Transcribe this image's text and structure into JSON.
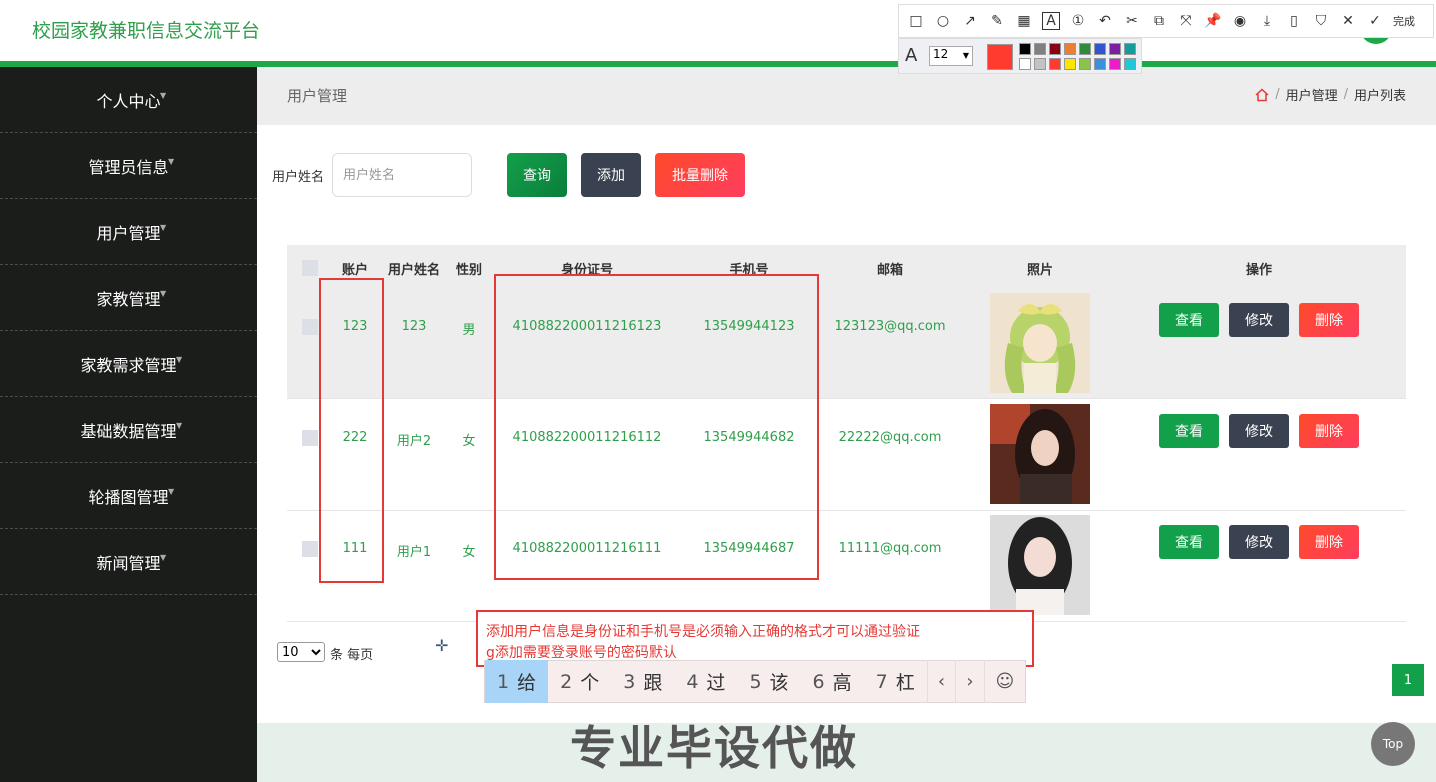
{
  "header": {
    "title": "校园家教兼职信息交流平台"
  },
  "sidebar": {
    "items": [
      {
        "label": "个人中心"
      },
      {
        "label": "管理员信息"
      },
      {
        "label": "用户管理"
      },
      {
        "label": "家教管理"
      },
      {
        "label": "家教需求管理"
      },
      {
        "label": "基础数据管理"
      },
      {
        "label": "轮播图管理"
      },
      {
        "label": "新闻管理"
      }
    ]
  },
  "page": {
    "title": "用户管理",
    "breadcrumb": [
      "用户管理",
      "用户列表"
    ],
    "breadcrumb_sep": "/"
  },
  "search": {
    "label": "用户姓名",
    "placeholder": "用户姓名",
    "query_label": "查询",
    "add_label": "添加",
    "batch_delete_label": "批量删除"
  },
  "table": {
    "columns": [
      "账户",
      "用户姓名",
      "性别",
      "身份证号",
      "手机号",
      "邮箱",
      "照片",
      "操作"
    ],
    "rows": [
      {
        "account": "123",
        "name": "123",
        "gender": "男",
        "id_card": "410882200011216123",
        "phone": "13549944123",
        "email": "123123@qq.com"
      },
      {
        "account": "222",
        "name": "用户2",
        "gender": "女",
        "id_card": "410882200011216112",
        "phone": "13549944682",
        "email": "22222@qq.com"
      },
      {
        "account": "111",
        "name": "用户1",
        "gender": "女",
        "id_card": "410882200011216111",
        "phone": "13549944687",
        "email": "11111@qq.com"
      }
    ],
    "actions": {
      "view": "查看",
      "edit": "修改",
      "delete": "删除"
    }
  },
  "annotation": {
    "line1": "添加用户信息是身份证和手机号是必须输入正确的格式才可以通过验证",
    "line2": "g添加需要登录账号的密码默认"
  },
  "pagination": {
    "page_size": "10",
    "page_size_label": "条 每页",
    "current_page": "1",
    "top_label": "Top"
  },
  "ime": {
    "candidates": [
      {
        "n": "1",
        "c": "给"
      },
      {
        "n": "2",
        "c": "个"
      },
      {
        "n": "3",
        "c": "跟"
      },
      {
        "n": "4",
        "c": "过"
      },
      {
        "n": "5",
        "c": "该"
      },
      {
        "n": "6",
        "c": "高"
      },
      {
        "n": "7",
        "c": "杠"
      }
    ],
    "prev": "‹",
    "next": "›",
    "emoji": "☺"
  },
  "watermark": "专业毕设代做",
  "screenshot_toolbar": {
    "done_label": "完成",
    "font_size": "12",
    "font_glyph": "A",
    "selected_color": "#ff3b30",
    "palette": [
      "#000000",
      "#7f7f7f",
      "#880015",
      "#ed7d31",
      "#2e8b3a",
      "#3155d1",
      "#7a1fa2",
      "#169b9b",
      "#ffffff",
      "#c3c3c3",
      "#ff3b30",
      "#ffe600",
      "#8bc34a",
      "#3d8fe0",
      "#e91ec9",
      "#22c8d8"
    ]
  },
  "colors": {
    "accent": "#1fa84a",
    "danger": "#ff3d5e",
    "dark": "#3a4150",
    "sidebar": "#1b1d1b"
  }
}
